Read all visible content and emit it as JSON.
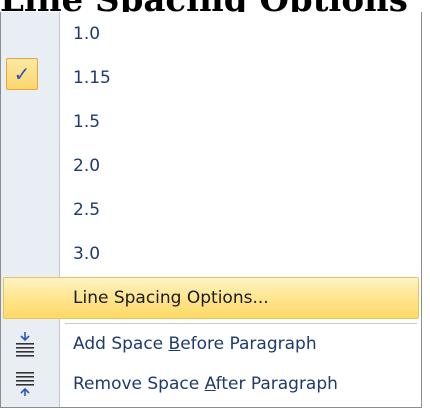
{
  "heading": "Line Spacing Options",
  "menu": {
    "items": [
      {
        "label": "1.0",
        "checked": false
      },
      {
        "label": "1.15",
        "checked": true
      },
      {
        "label": "1.5",
        "checked": false
      },
      {
        "label": "2.0",
        "checked": false
      },
      {
        "label": "2.5",
        "checked": false
      },
      {
        "label": "3.0",
        "checked": false
      }
    ],
    "check_glyph": "✓",
    "options_label": "Line Spacing Options...",
    "add_before": {
      "pre": "Add Space ",
      "key": "B",
      "post": "efore Paragraph",
      "icon": "add-space-before-icon"
    },
    "remove_after": {
      "pre": "Remove Space ",
      "key": "A",
      "post": "fter Paragraph",
      "icon": "remove-space-after-icon"
    }
  },
  "colors": {
    "label_text": "#1e3a6e",
    "highlight": "#ffe48a",
    "check_border": "#e7a73a",
    "icon_blue": "#2a55c0"
  }
}
